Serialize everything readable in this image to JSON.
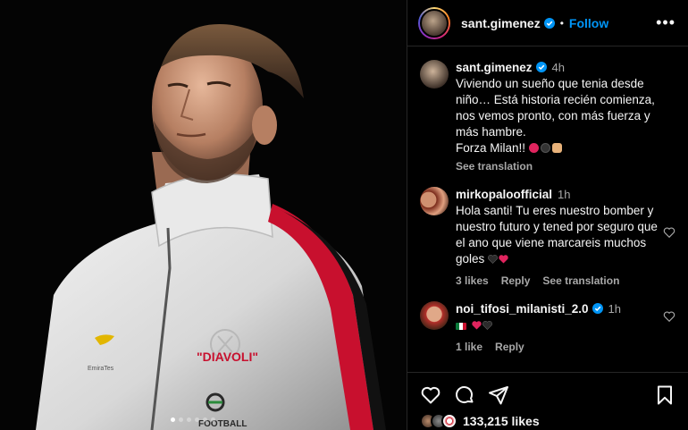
{
  "post": {
    "username": "sant.gimenez",
    "follow_label": "Follow",
    "separator": "•",
    "more_label": "•••",
    "caption": {
      "username": "sant.gimenez",
      "time": "4h",
      "text": "Viviendo un sueño que tenia desde niño… Está historia recién comienza, nos vemos pronto, con más fuerza y más hambre.",
      "text2": "Forza Milan!!",
      "see_translation": "See translation"
    },
    "comments": [
      {
        "username": "mirkopaloofficial",
        "time": "1h",
        "text": "Hola santi! Tu eres nuestro bomber y nuestro futuro y tened por seguro que el ano que viene marcareis muchos goles",
        "likes": "3 likes",
        "reply": "Reply",
        "see_translation": "See translation"
      },
      {
        "username": "noi_tifosi_milanisti_2.0",
        "time": "1h",
        "likes": "1 like",
        "reply": "Reply"
      }
    ],
    "likes_count": "133,215 likes"
  },
  "jersey": {
    "sponsor_text": "\"DIAVOLI\"",
    "brand_text": "FOOTBALL",
    "kit_text": "EmiraTes"
  },
  "colors": {
    "follow": "#0095f6",
    "background": "#000000",
    "muted": "#a8a8a8",
    "jersey_stripe": "#c8102e"
  },
  "photo_dots": {
    "count": 6,
    "active_index": 0
  },
  "icons": [
    "verified-badge-icon",
    "more-options-icon",
    "heart-icon",
    "comment-icon",
    "share-icon",
    "bookmark-icon"
  ]
}
